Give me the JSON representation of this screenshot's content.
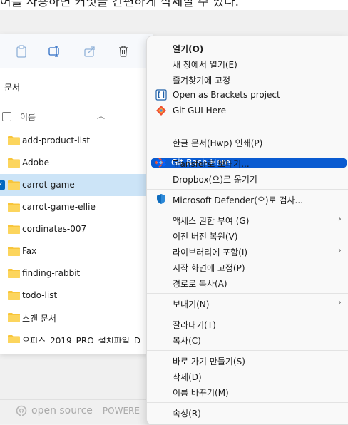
{
  "caption": "어를 사용하면 커밋을 간편하게 삭제할 수 있다.",
  "address": {
    "path": "문서"
  },
  "columns": {
    "name": "이름"
  },
  "files": [
    {
      "name": "add-product-list",
      "selected": false
    },
    {
      "name": "Adobe",
      "selected": false
    },
    {
      "name": "carrot-game",
      "selected": true
    },
    {
      "name": "carrot-game-ellie",
      "selected": false
    },
    {
      "name": "cordinates-007",
      "selected": false
    },
    {
      "name": "Fax",
      "selected": false
    },
    {
      "name": "finding-rabbit",
      "selected": false
    },
    {
      "name": "todo-list",
      "selected": false
    },
    {
      "name": "스캔 문서",
      "selected": false
    },
    {
      "name": "오피스_2019_PRO_설치파일_D",
      "selected": false
    }
  ],
  "brand": {
    "name": "open source",
    "powered": "POWERE"
  },
  "menu": {
    "open": "열기(O)",
    "open_new_window": "새 창에서 열기(E)",
    "pin_favorites": "즐겨찾기에 고정",
    "brackets": "Open as Brackets project",
    "git_gui": "Git GUI Here",
    "git_bash": "Git Bash Here",
    "hwp_print": "한글 문서(Hwp) 인쇄(P)",
    "transfer": "Transfer로 보내기...",
    "dropbox": "Dropbox(으)로 옮기기",
    "defender": "Microsoft Defender(으)로 검사...",
    "grant_access": "액세스 권한 부여 (G)",
    "restore_prev": "이전 버전 복원(V)",
    "include_library": "라이브러리에 포함(I)",
    "pin_start": "시작 화면에 고정(P)",
    "copy_path": "경로로 복사(A)",
    "send_to": "보내기(N)",
    "cut": "잘라내기(T)",
    "copy": "복사(C)",
    "create_shortcut": "바로 가기 만들기(S)",
    "delete": "삭제(D)",
    "rename": "이름 바꾸기(M)",
    "properties": "속성(R)"
  },
  "colors": {
    "accent": "#0a5bd1",
    "selection": "#cce4f7",
    "folder": "#f8c53a"
  }
}
